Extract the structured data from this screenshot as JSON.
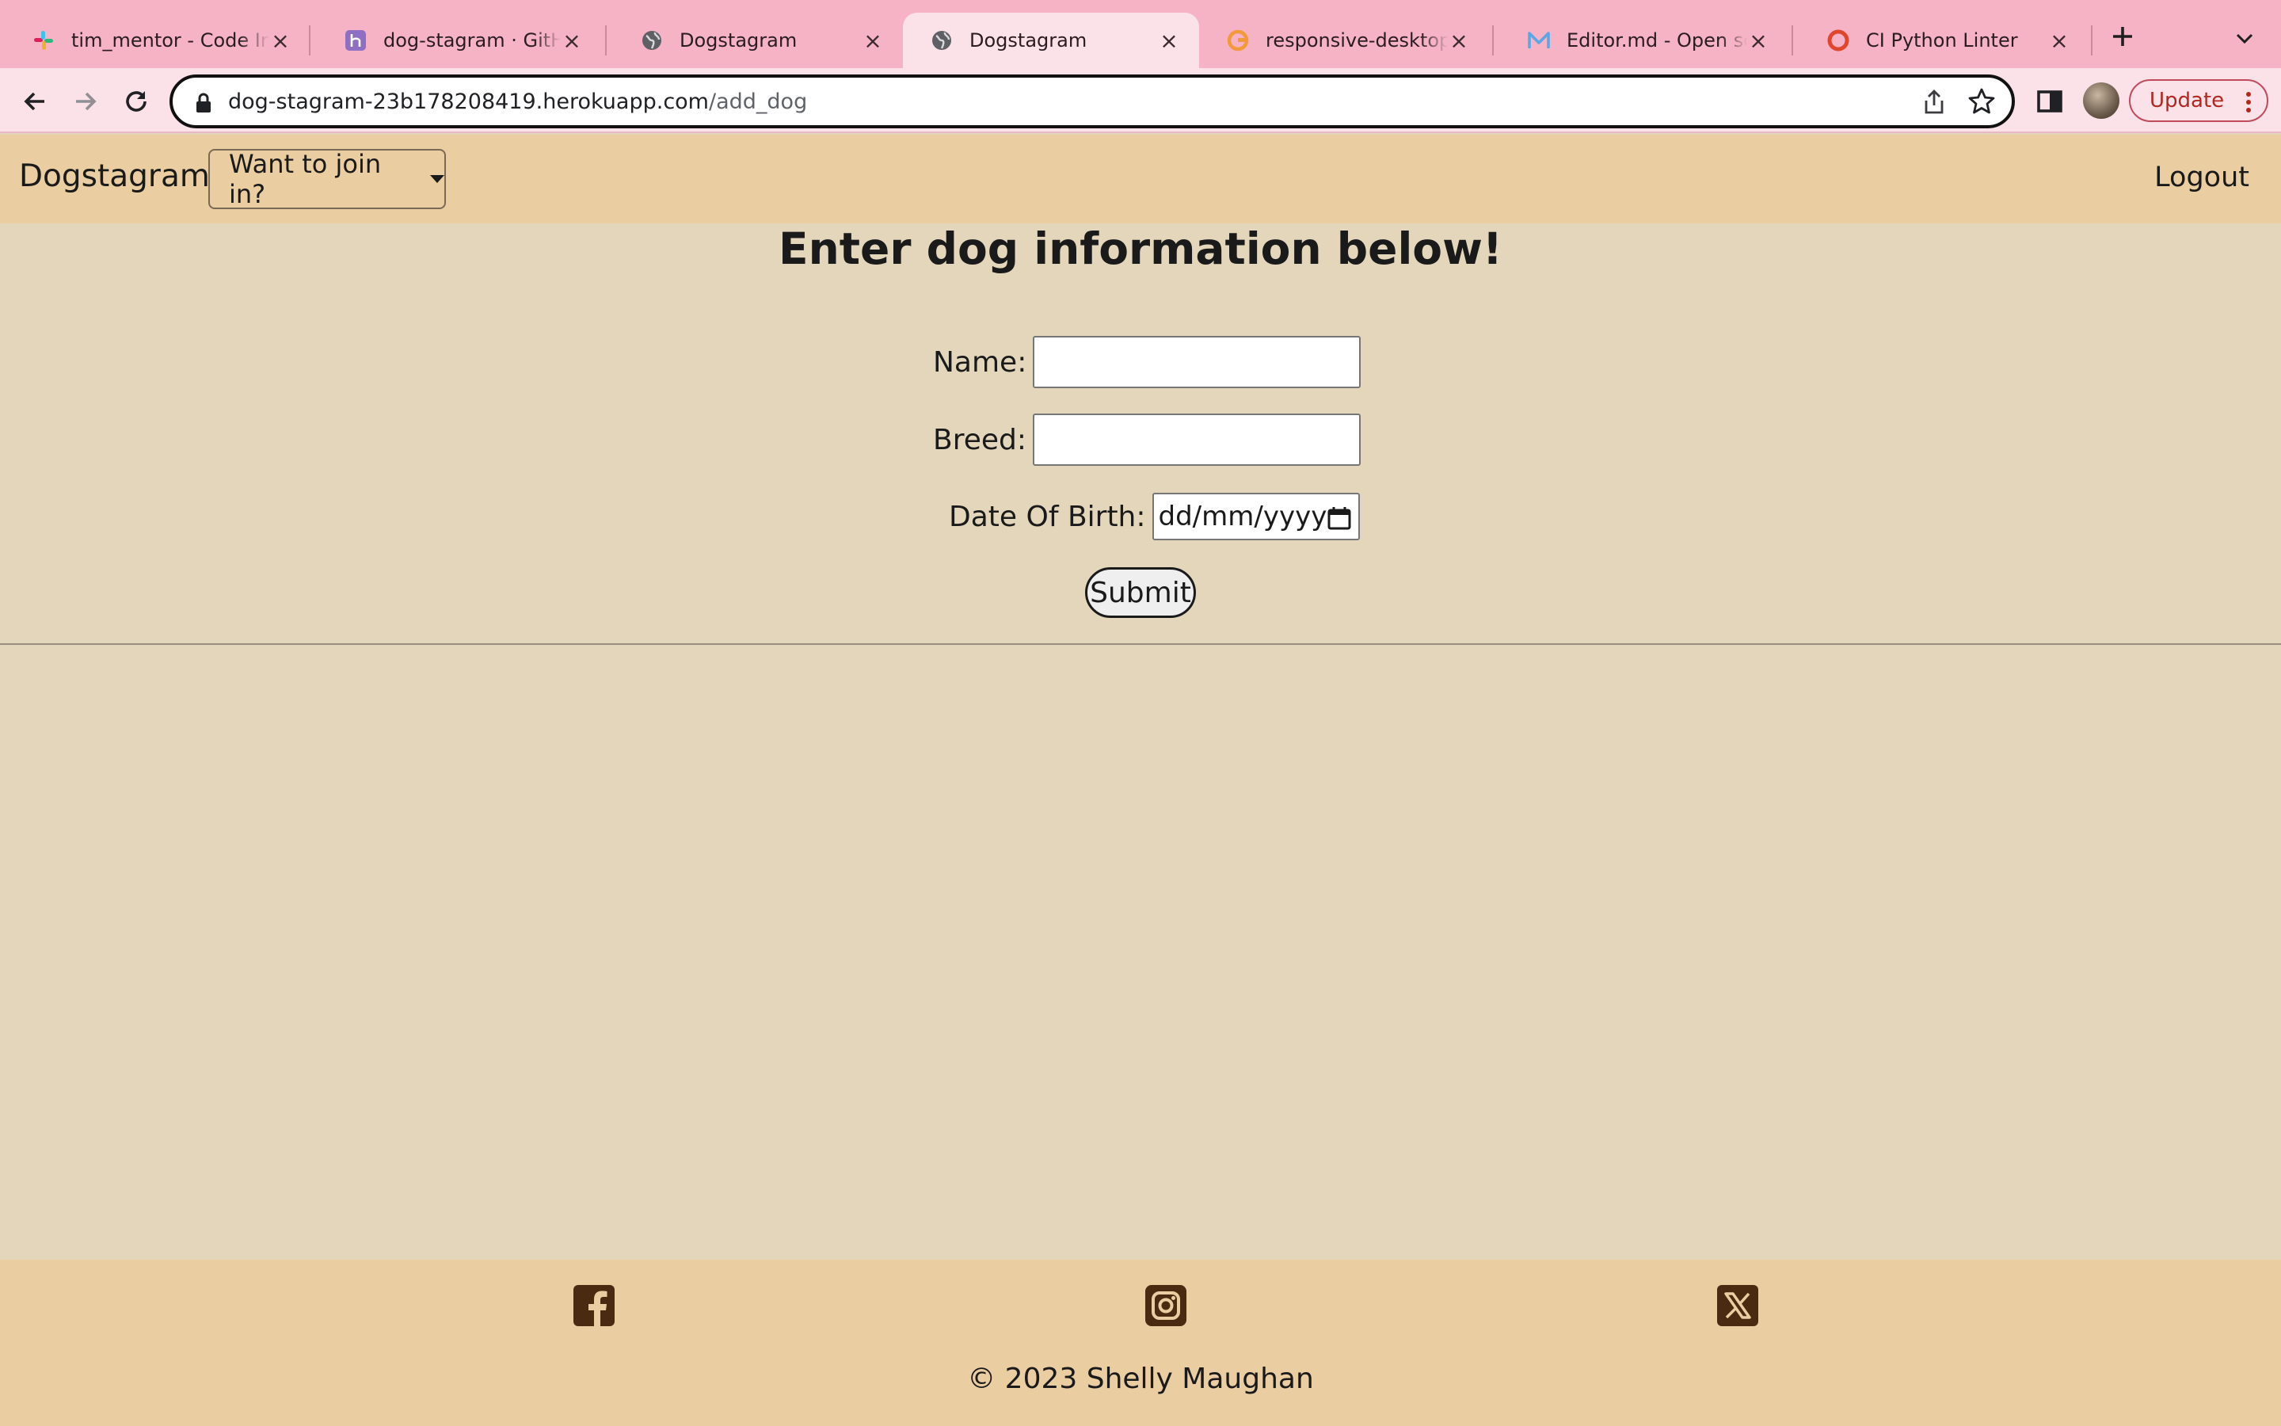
{
  "browser": {
    "tabs": [
      {
        "title": "tim_mentor - Code Institute",
        "icon": "slack-icon",
        "active": false
      },
      {
        "title": "dog-stagram · GitHub",
        "icon": "heroku-icon",
        "active": false
      },
      {
        "title": "Dogstagram",
        "icon": "globe-icon",
        "active": false
      },
      {
        "title": "Dogstagram",
        "icon": "globe-icon",
        "active": true
      },
      {
        "title": "responsive-desktop-",
        "icon": "google-icon",
        "active": false
      },
      {
        "title": "Editor.md - Open source",
        "icon": "editor-md-icon",
        "active": false
      },
      {
        "title": "CI Python Linter",
        "icon": "ci-icon",
        "active": false
      }
    ],
    "address": {
      "host": "dog-stagram-23b178208419.herokuapp.com",
      "path": "/add_dog"
    },
    "update_label": "Update",
    "colors": {
      "tabbar": "#f5b3c5",
      "toolbar": "#fbe1e8"
    }
  },
  "site": {
    "brand": "Dogstagram",
    "dropdown_label": "Want to join in?",
    "logout_label": "Logout",
    "colors": {
      "nav": "#ebcda2",
      "page": "#e4d6bb",
      "icons": "#4a2a10"
    }
  },
  "form": {
    "heading": "Enter dog information below!",
    "name_label": "Name:",
    "breed_label": "Breed:",
    "dob_label": "Date Of Birth:",
    "dob_placeholder": "dd/mm/yyyy",
    "submit_label": "Submit"
  },
  "footer": {
    "icons": [
      "facebook-icon",
      "instagram-icon",
      "x-twitter-icon"
    ],
    "copyright": "© 2023 Shelly Maughan"
  }
}
